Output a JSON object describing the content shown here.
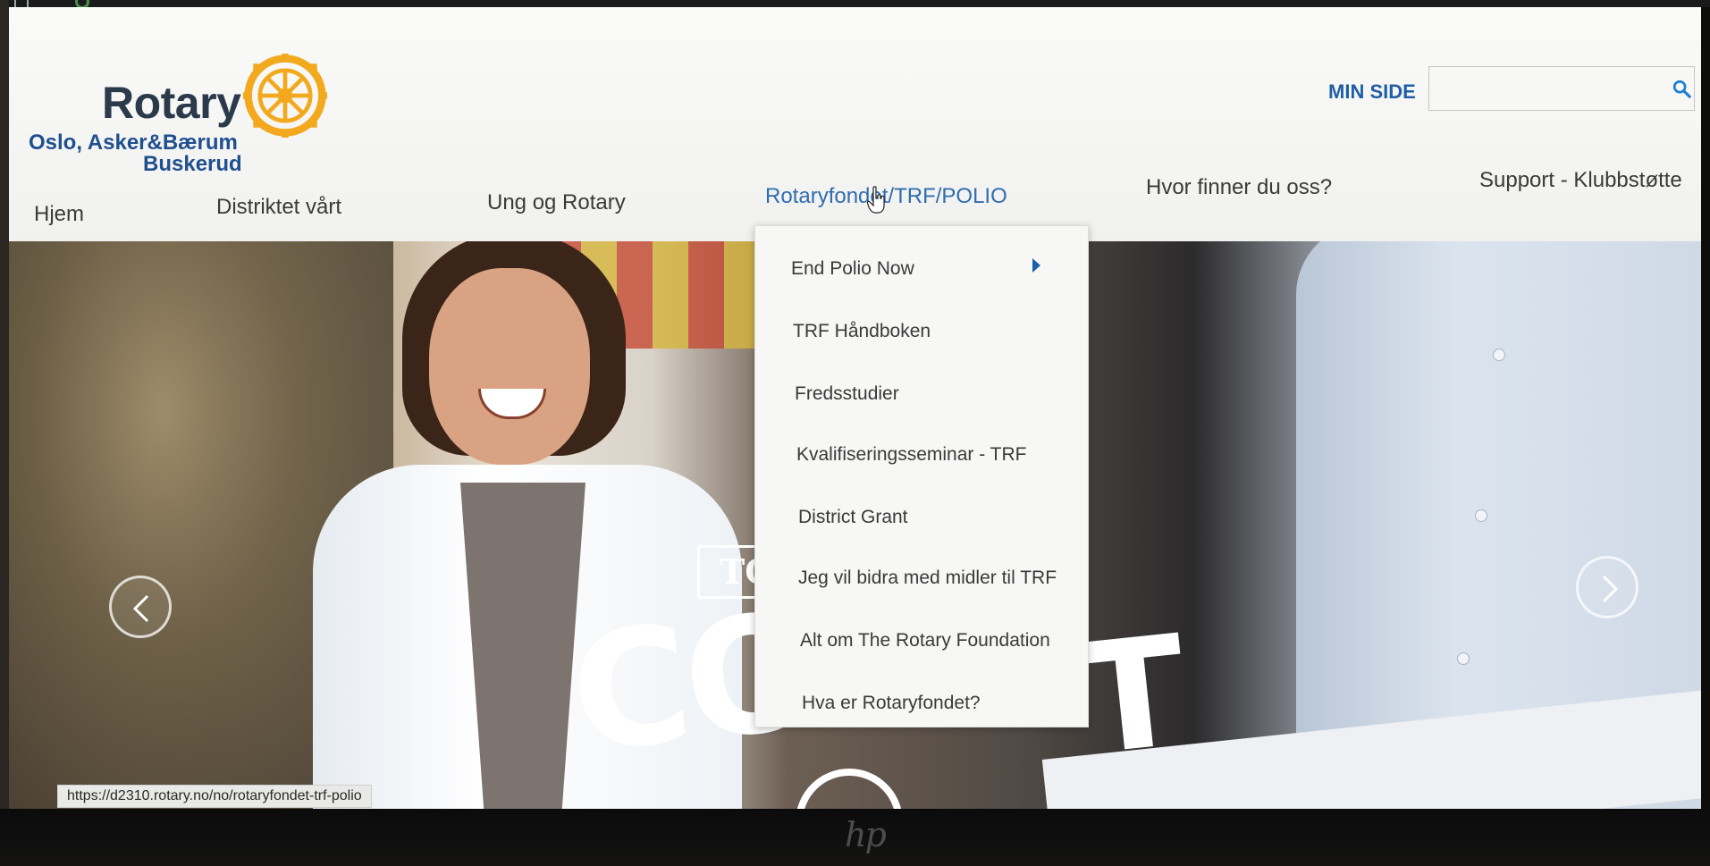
{
  "header": {
    "logo_word": "Rotary",
    "logo_sub_line1": "Oslo, Asker&Bærum",
    "logo_sub_line2": "Buskerud",
    "min_side_label": "MIN SIDE",
    "search": {
      "value": "",
      "placeholder": ""
    }
  },
  "nav": {
    "items": [
      {
        "label": "Hjem"
      },
      {
        "label": "Distriktet vårt"
      },
      {
        "label": "Ung og Rotary"
      },
      {
        "label": "Rotaryfondet/TRF/POLIO"
      },
      {
        "label": "Hvor finner du oss?"
      },
      {
        "label": "Support - Klubbstøtte"
      }
    ],
    "active_index": 3
  },
  "dropdown": {
    "items": [
      {
        "label": "End Polio Now",
        "has_submenu": true
      },
      {
        "label": "TRF Håndboken"
      },
      {
        "label": "Fredsstudier"
      },
      {
        "label": "Kvalifiseringsseminar - TRF"
      },
      {
        "label": "District Grant"
      },
      {
        "label": "Jeg vil bidra med midler til TRF"
      },
      {
        "label": "Alt om The Rotary Foundation"
      },
      {
        "label": "Hva er Rotaryfondet?"
      }
    ]
  },
  "hero": {
    "text_box": "TO",
    "big_text": "CO",
    "big_text_right": "T"
  },
  "status_bar": {
    "url": "https://d2310.rotary.no/no/rotaryfondet-trf-polio"
  },
  "device": {
    "brand_mark": "hp"
  },
  "colors": {
    "brand_blue": "#1f5fa8",
    "rotary_gold": "#f2a91d",
    "nav_text": "#3a3a3a",
    "nav_active": "#2f6db0"
  },
  "icons": {
    "search": "search-icon",
    "prev": "chevron-left-icon",
    "next": "chevron-right-icon",
    "submenu": "triangle-right-icon",
    "cursor": "hand-cursor-icon",
    "logo": "rotary-wheel-icon"
  }
}
